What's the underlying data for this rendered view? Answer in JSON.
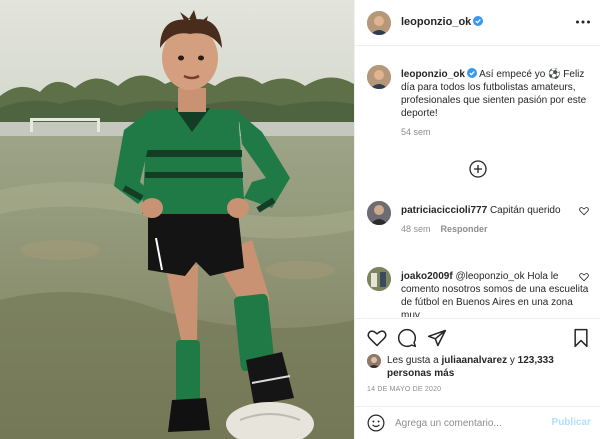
{
  "post": {
    "username": "leoponzio_ok",
    "verified": true,
    "header_icons": [
      "verified-badge-icon",
      "more-options-icon"
    ]
  },
  "caption": {
    "username": "leoponzio_ok",
    "text": "Así empecé yo ⚽ Feliz día para todos los futbolistas amateurs, profesionales que sienten pasión por este deporte!",
    "time": "54 sem"
  },
  "comments": [
    {
      "username": "patriciaciccioli777",
      "text": "Capitán querido",
      "time": "48 sem",
      "reply_label": "Responder"
    },
    {
      "username": "joako2009f",
      "text": "@leoponzio_ok Hola le comento nosotros somos de una escuelita de fútbol en Buenos Aires en una zona muy"
    }
  ],
  "likes": {
    "prefix": "Les gusta a",
    "user": "juliaanalvarez",
    "middle": " y ",
    "count": "123,333 personas más"
  },
  "date": "14 DE MAYO DE 2020",
  "composer": {
    "placeholder": "Agrega un comentario...",
    "publish_label": "Publicar"
  },
  "colors": {
    "verified": "#3897f0",
    "publish_disabled": "#b2dffc",
    "secondary_text": "#8e8e8e",
    "jersey": "#1f7a45"
  },
  "icons": [
    "heart-icon",
    "comment-icon",
    "share-icon",
    "bookmark-icon",
    "emoji-icon",
    "load-more-icon"
  ]
}
